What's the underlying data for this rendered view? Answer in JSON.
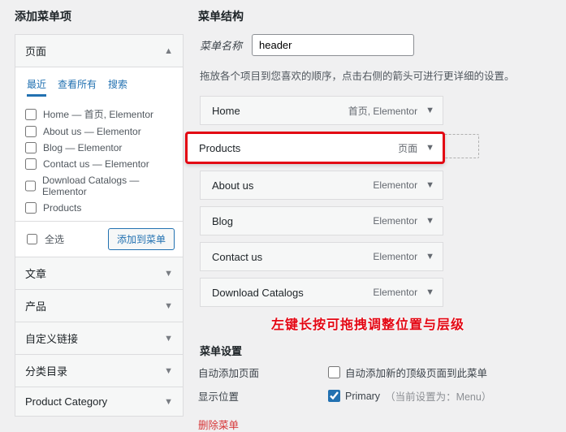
{
  "left": {
    "title": "添加菜单项",
    "pages": {
      "head": "页面",
      "tabs": [
        "最近",
        "查看所有",
        "搜索"
      ],
      "items": [
        "Home — 首页, Elementor",
        "About us — Elementor",
        "Blog — Elementor",
        "Contact us — Elementor",
        "Download Catalogs — Elementor",
        "Products"
      ],
      "select_all": "全选",
      "add_btn": "添加到菜单"
    },
    "accordions": [
      "文章",
      "产品",
      "自定义链接",
      "分类目录",
      "Product Category"
    ]
  },
  "right": {
    "title": "菜单结构",
    "name_label": "菜单名称",
    "name_value": "header",
    "desc": "拖放各个项目到您喜欢的顺序，点击右侧的箭头可进行更详细的设置。",
    "items": [
      {
        "label": "Home",
        "tag": "首页, Elementor"
      },
      {
        "label": "Products",
        "tag": "页面",
        "dragging": true
      },
      {
        "label": "About us",
        "tag": "Elementor"
      },
      {
        "label": "Blog",
        "tag": "Elementor"
      },
      {
        "label": "Contact us",
        "tag": "Elementor"
      },
      {
        "label": "Download Catalogs",
        "tag": "Elementor"
      }
    ],
    "annotation": "左键长按可拖拽调整位置与层级",
    "settings": {
      "title": "菜单设置",
      "auto_label": "自动添加页面",
      "auto_desc": "自动添加新的顶级页面到此菜单",
      "loc_label": "显示位置",
      "loc_name": "Primary",
      "loc_note": "（当前设置为：Menu）"
    },
    "delete": "删除菜单"
  }
}
